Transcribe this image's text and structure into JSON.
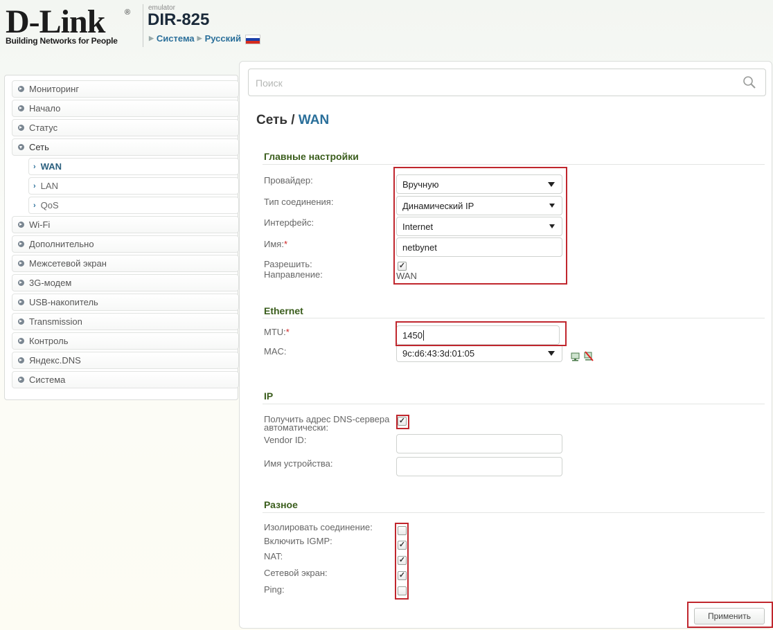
{
  "header": {
    "logo_text": "D-Link",
    "logo_registered": "®",
    "tagline": "Building Networks for People",
    "emulator_label": "emulator",
    "model": "DIR-825",
    "breadcrumb": [
      "Система",
      "Русский"
    ]
  },
  "sidebar": {
    "items": [
      {
        "label": "Мониторинг"
      },
      {
        "label": "Начало"
      },
      {
        "label": "Статус"
      },
      {
        "label": "Сеть",
        "expanded": true
      },
      {
        "label": "WAN",
        "sub": true,
        "active": true
      },
      {
        "label": "LAN",
        "sub": true
      },
      {
        "label": "QoS",
        "sub": true
      },
      {
        "label": "Wi-Fi"
      },
      {
        "label": "Дополнительно"
      },
      {
        "label": "Межсетевой экран"
      },
      {
        "label": "3G-модем"
      },
      {
        "label": "USB-накопитель"
      },
      {
        "label": "Transmission"
      },
      {
        "label": "Контроль"
      },
      {
        "label": "Яндекс.DNS"
      },
      {
        "label": "Система"
      }
    ]
  },
  "search": {
    "placeholder": "Поиск"
  },
  "page": {
    "title_prefix": "Сеть / ",
    "title_main": "WAN"
  },
  "main_settings": {
    "title": "Главные настройки",
    "provider_label": "Провайдер:",
    "provider_value": "Вручную",
    "conn_type_label": "Тип соединения:",
    "conn_type_value": "Динамический IP",
    "interface_label": "Интерфейс:",
    "interface_value": "Internet",
    "name_label": "Имя:",
    "name_value": "netbynet",
    "allow_label": "Разрешить:",
    "allow_checked": true,
    "direction_label": "Направление:",
    "direction_value": "WAN"
  },
  "ethernet": {
    "title": "Ethernet",
    "mtu_label": "MTU:",
    "mtu_value": "1450",
    "mac_label": "MAC:",
    "mac_value": "9c:d6:43:3d:01:05"
  },
  "ip": {
    "title": "IP",
    "dns_auto_label_1": "Получить адрес DNS-сервера",
    "dns_auto_label_2": "автоматически:",
    "dns_auto_checked": true,
    "vendor_label": "Vendor ID:",
    "vendor_value": "",
    "device_label": "Имя устройства:",
    "device_value": ""
  },
  "misc": {
    "title": "Разное",
    "isolate_label": "Изолировать соединение:",
    "isolate_checked": false,
    "igmp_label": "Включить IGMP:",
    "igmp_checked": true,
    "nat_label": "NAT:",
    "nat_checked": true,
    "firewall_label": "Сетевой экран:",
    "firewall_checked": true,
    "ping_label": "Ping:",
    "ping_checked": false
  },
  "apply_label": "Применить",
  "colors": {
    "accent": "#2a6f9a",
    "section": "#3a5d1c",
    "highlight": "#c0262d"
  },
  "icons": [
    "search-icon",
    "computer-icon",
    "remove-icon",
    "flag-icon"
  ]
}
